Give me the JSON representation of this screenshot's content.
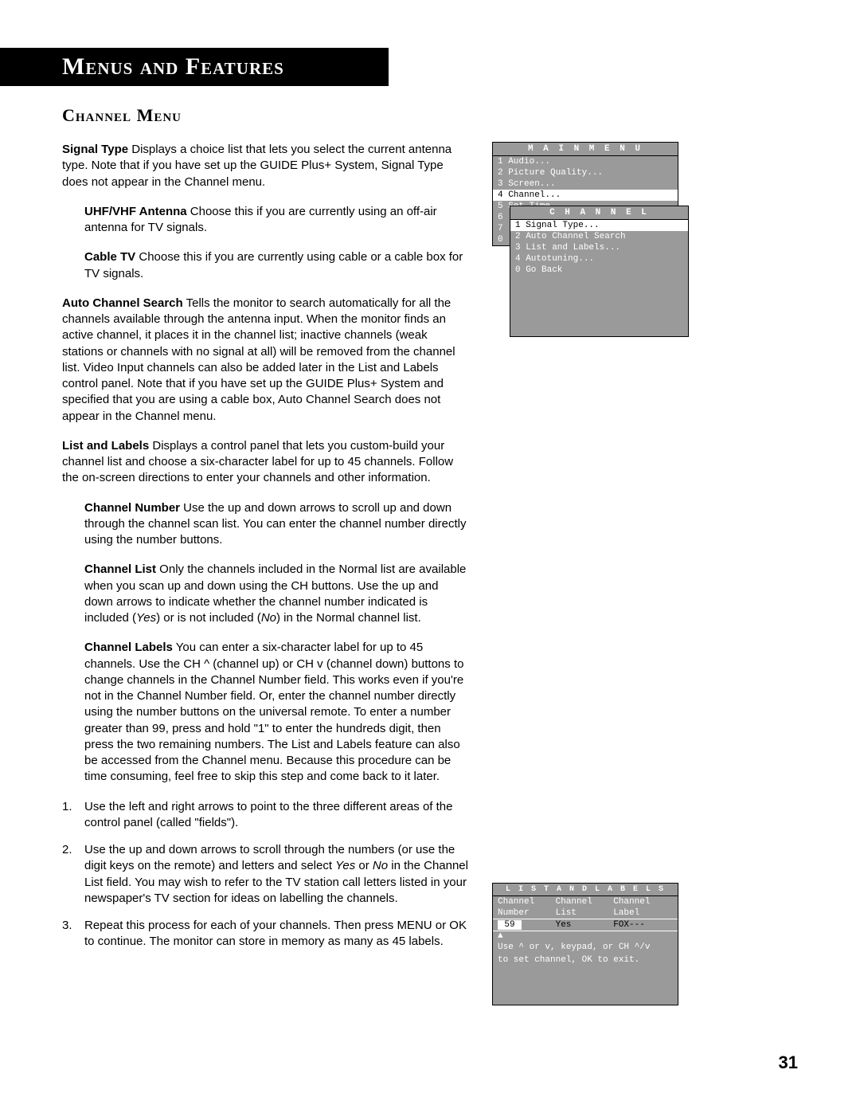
{
  "banner": "Menus and Features",
  "section_title": "Channel Menu",
  "page_number": "31",
  "signal_type": {
    "label": "Signal Type",
    "body": "   Displays a choice list that lets you select the current antenna type. Note that if you have set up the GUIDE Plus+ System, Signal Type does not appear in the Channel menu."
  },
  "uhf": {
    "label": "UHF/VHF Antenna",
    "body": "  Choose this if you are currently using an off-air antenna for TV signals."
  },
  "cable": {
    "label": "Cable TV",
    "body": "  Choose this if you are currently using cable or a cable box for TV signals."
  },
  "acs": {
    "label": "Auto Channel Search",
    "body": "  Tells the monitor to search automatically for all the channels available through the antenna input. When the monitor finds an active channel, it places it in the channel list; inactive channels (weak stations or channels with no signal at all) will be removed from the channel list. Video Input channels can also be added later in the List and Labels control panel. Note that if you have set up the GUIDE Plus+ System and specified that you are using a cable box, Auto Channel Search does not appear in the Channel menu."
  },
  "ll": {
    "label": "List and Labels",
    "body": "   Displays a control panel that lets you custom-build your channel list and choose a six-character label for up to 45 channels. Follow the on-screen directions to enter your channels and other information."
  },
  "cn": {
    "label": "Channel Number",
    "body": "   Use the up and down arrows to scroll up and down through the channel scan list. You can enter the channel number directly using the number buttons."
  },
  "cl": {
    "label": "Channel List",
    "body_1": "   Only the channels included in the Normal list are available when you scan up and down using the CH buttons. Use the up and down arrows to indicate whether the channel number indicated is included (",
    "yes": "Yes",
    "body_2": ") or is not included (",
    "no": "No",
    "body_3": ") in the Normal channel list."
  },
  "clab": {
    "label": "Channel Labels",
    "body": "   You can enter a six-character label for up to 45 channels. Use the CH ^ (channel up) or CH v (channel down) buttons to change channels in the Channel Number field. This works even if you're not in the Channel Number field. Or, enter the channel number directly using the number buttons on the universal remote. To enter a number greater than 99, press and hold \"1\" to enter the hundreds digit, then press the two remaining numbers. The List and Labels feature can also be accessed from the Channel menu. Because this procedure can be time consuming, feel free to skip this step and come back to it later."
  },
  "steps": {
    "n1": "1.",
    "t1": "Use the left and right arrows to point to the three different areas of the control panel (called \"fields\").",
    "n2": "2.",
    "t2_a": "Use the up and down arrows to scroll through the numbers (or use the digit keys on the remote) and letters and select ",
    "t2_yes": "Yes",
    "t2_b": " or ",
    "t2_no": "No",
    "t2_c": " in the Channel List field. You may wish to refer to the TV station call letters listed in your newspaper's TV section for ideas on labelling the channels.",
    "n3": "3.",
    "t3": "Repeat this process for each of your channels. Then press MENU or OK to continue. The monitor can store in memory as many as 45 labels."
  },
  "osd_main": {
    "title": "M A I N   M E N U",
    "i1": "1 Audio...",
    "i2": "2 Picture Quality...",
    "i3": "3 Screen...",
    "i4": "4 Channel...",
    "i5": "5 Set Time...",
    "i6": "6",
    "i7": "7",
    "i8": "0"
  },
  "osd_channel": {
    "title": "C H A N N E L",
    "i1": "1 Signal Type...",
    "i2": "2 Auto Channel Search",
    "i3": "3 List and Labels...",
    "i4": "4 Autotuning...",
    "i5": "0 Go Back"
  },
  "osd_ll": {
    "title": "L I S T   A N D   L A B E L S",
    "h1": "Channel",
    "h2": "Channel",
    "h3": "Channel",
    "s1": "Number",
    "s2": "List",
    "s3": "Label",
    "v1": "59",
    "v2": "Yes",
    "v3": "FOX---",
    "help1": "Use ^ or v, keypad, or CH ^/v",
    "help2": "to set channel, OK to exit.",
    "arrow": "▲"
  }
}
